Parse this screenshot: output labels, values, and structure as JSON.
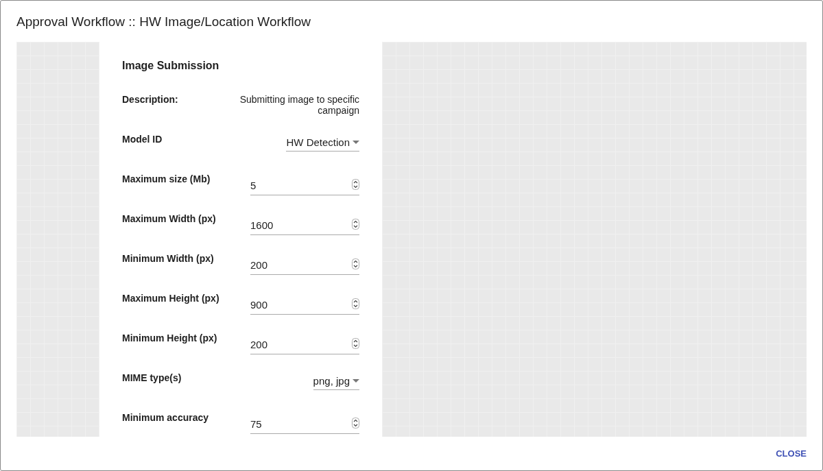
{
  "dialog": {
    "title": "Approval Workflow :: HW Image/Location Workflow"
  },
  "form": {
    "heading": "Image Submission",
    "fields": [
      {
        "kind": "text",
        "label": "Description:",
        "value": "Submitting image to specific campaign"
      },
      {
        "kind": "select",
        "label": "Model ID",
        "value": "HW Detection"
      },
      {
        "kind": "number",
        "label": "Maximum size (Mb)",
        "value": "5"
      },
      {
        "kind": "number",
        "label": "Maximum Width (px)",
        "value": "1600"
      },
      {
        "kind": "number",
        "label": "Minimum Width (px)",
        "value": "200"
      },
      {
        "kind": "number",
        "label": "Maximum Height (px)",
        "value": "900"
      },
      {
        "kind": "number",
        "label": "Minimum Height (px)",
        "value": "200"
      },
      {
        "kind": "select",
        "label": "MIME type(s)",
        "value": "png, jpg"
      },
      {
        "kind": "number",
        "label": "Minimum accuracy",
        "value": "75"
      }
    ]
  },
  "actions": [
    {
      "label": "CLOSE"
    }
  ]
}
